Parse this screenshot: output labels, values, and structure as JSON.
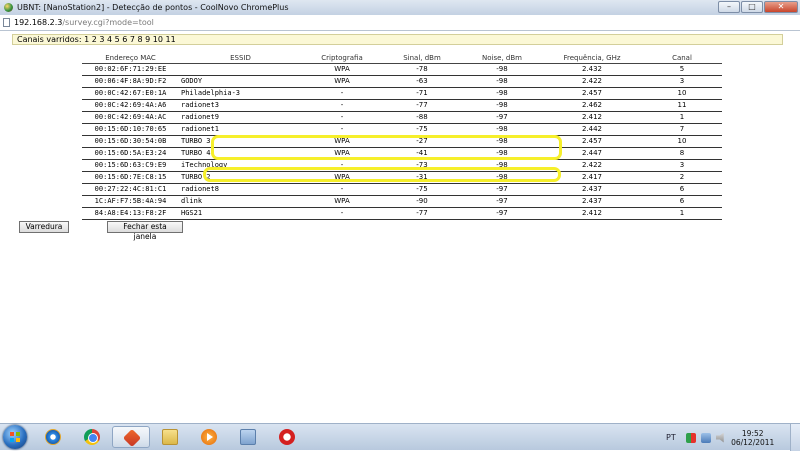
{
  "window": {
    "title": "UBNT: [NanoStation2] - Detecção de pontos - CoolNovo ChromePlus",
    "minimize": "–",
    "maximize": "□",
    "close": "✕"
  },
  "address": {
    "host": "192.168.2.3",
    "path": "/survey.cgi?mode=tool"
  },
  "page": {
    "channels_scanned": "Canais varridos: 1 2 3 4 5 6 7 8 9 10 11",
    "columns": [
      "Endereço MAC",
      "ESSID",
      "Criptografia",
      "Sinal, dBm",
      "Noise, dBm",
      "Frequência, GHz",
      "Canal"
    ],
    "rows": [
      {
        "mac": "00:02:6F:71:29:EE",
        "essid": "",
        "crypto": "WPA",
        "signal": "-78",
        "noise": "-98",
        "freq": "2.432",
        "channel": "5"
      },
      {
        "mac": "00:06:4F:8A:9D:F2",
        "essid": "GODOY",
        "crypto": "WPA",
        "signal": "-63",
        "noise": "-98",
        "freq": "2.422",
        "channel": "3"
      },
      {
        "mac": "00:0C:42:67:E0:1A",
        "essid": "Philadelphia-3",
        "crypto": "-",
        "signal": "-71",
        "noise": "-98",
        "freq": "2.457",
        "channel": "10"
      },
      {
        "mac": "00:0C:42:69:4A:A6",
        "essid": "radionet3",
        "crypto": "-",
        "signal": "-77",
        "noise": "-98",
        "freq": "2.462",
        "channel": "11"
      },
      {
        "mac": "00:0C:42:69:4A:AC",
        "essid": "radionet9",
        "crypto": "-",
        "signal": "-88",
        "noise": "-97",
        "freq": "2.412",
        "channel": "1"
      },
      {
        "mac": "00:15:6D:10:70:65",
        "essid": "radionet1",
        "crypto": "-",
        "signal": "-75",
        "noise": "-98",
        "freq": "2.442",
        "channel": "7"
      },
      {
        "mac": "00:15:6D:30:54:0B",
        "essid": "TURBO 3",
        "crypto": "WPA",
        "signal": "-27",
        "noise": "-98",
        "freq": "2.457",
        "channel": "10"
      },
      {
        "mac": "00:15:6D:5A:E3:24",
        "essid": "TURBO 4",
        "crypto": "WPA",
        "signal": "-41",
        "noise": "-98",
        "freq": "2.447",
        "channel": "8"
      },
      {
        "mac": "00:15:6D:63:C9:E9",
        "essid": "iTechnology",
        "crypto": "-",
        "signal": "-73",
        "noise": "-98",
        "freq": "2.422",
        "channel": "3"
      },
      {
        "mac": "00:15:6D:7E:C8:15",
        "essid": "TURBO 2",
        "crypto": "WPA",
        "signal": "-31",
        "noise": "-98",
        "freq": "2.417",
        "channel": "2"
      },
      {
        "mac": "00:27:22:4C:81:C1",
        "essid": "radionet8",
        "crypto": "-",
        "signal": "-75",
        "noise": "-97",
        "freq": "2.437",
        "channel": "6"
      },
      {
        "mac": "1C:AF:F7:5B:4A:94",
        "essid": "dlink",
        "crypto": "WPA",
        "signal": "-90",
        "noise": "-97",
        "freq": "2.437",
        "channel": "6"
      },
      {
        "mac": "84:A8:E4:13:F8:2F",
        "essid": "HGS21",
        "crypto": "-",
        "signal": "-77",
        "noise": "-97",
        "freq": "2.412",
        "channel": "1"
      }
    ],
    "scan_button": "Varredura",
    "close_button": "Fechar esta janela"
  },
  "taskbar": {
    "apps": [
      "internet-explorer",
      "chrome",
      "coolnovo",
      "file-explorer",
      "media-player",
      "network-tool",
      "red-app"
    ],
    "active_app": "coolnovo",
    "language": "PT",
    "time": "19:52",
    "date": "06/12/2011"
  },
  "colors": {
    "highlight": "#f6ef2a",
    "channels_bar": "#fbf8d6"
  }
}
